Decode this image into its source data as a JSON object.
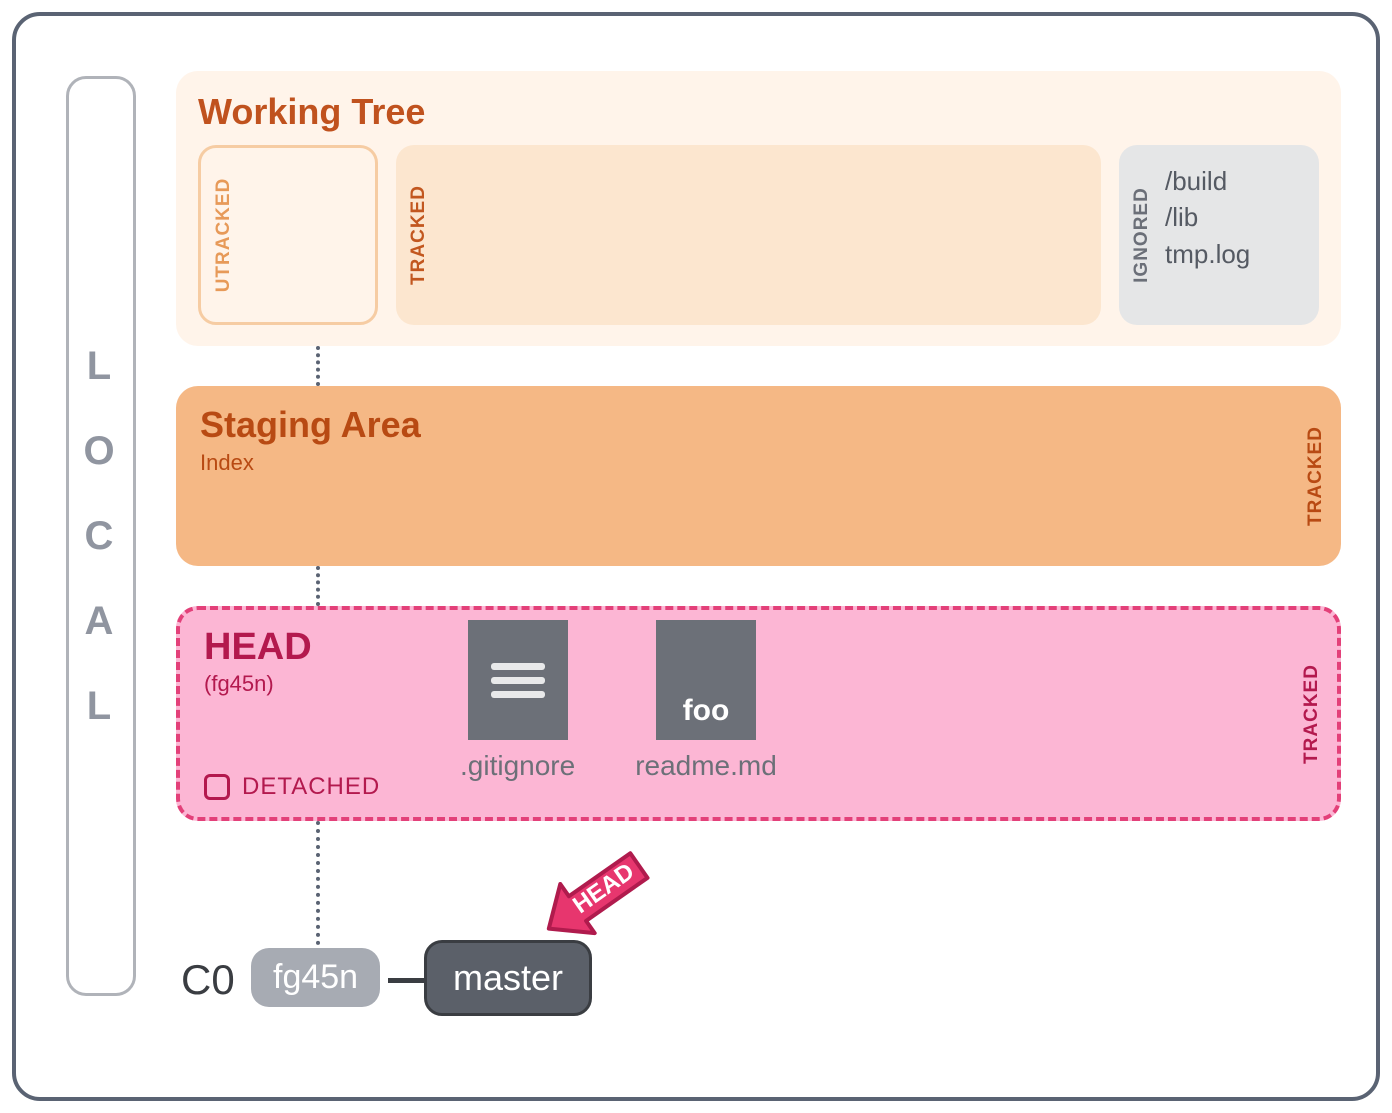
{
  "sidebar": {
    "letters": [
      "L",
      "O",
      "C",
      "A",
      "L"
    ]
  },
  "working_tree": {
    "title": "Working Tree",
    "untracked_label": "UTRACKED",
    "tracked_label": "TRACKED",
    "ignored_label": "IGNORED",
    "ignored_files": [
      "/build",
      "/lib",
      "tmp.log"
    ]
  },
  "staging": {
    "title": "Staging Area",
    "subtitle": "Index",
    "tracked_label": "TRACKED"
  },
  "head": {
    "title": "HEAD",
    "subtitle": "(fg45n)",
    "detached_label": "DETACHED",
    "tracked_label": "TRACKED",
    "files": [
      {
        "icon": "lines",
        "name": ".gitignore"
      },
      {
        "icon": "foo",
        "text": "foo",
        "name": "readme.md"
      }
    ]
  },
  "commit": {
    "label": "C0",
    "hash": "fg45n",
    "branch": "master",
    "arrow_label": "HEAD"
  }
}
